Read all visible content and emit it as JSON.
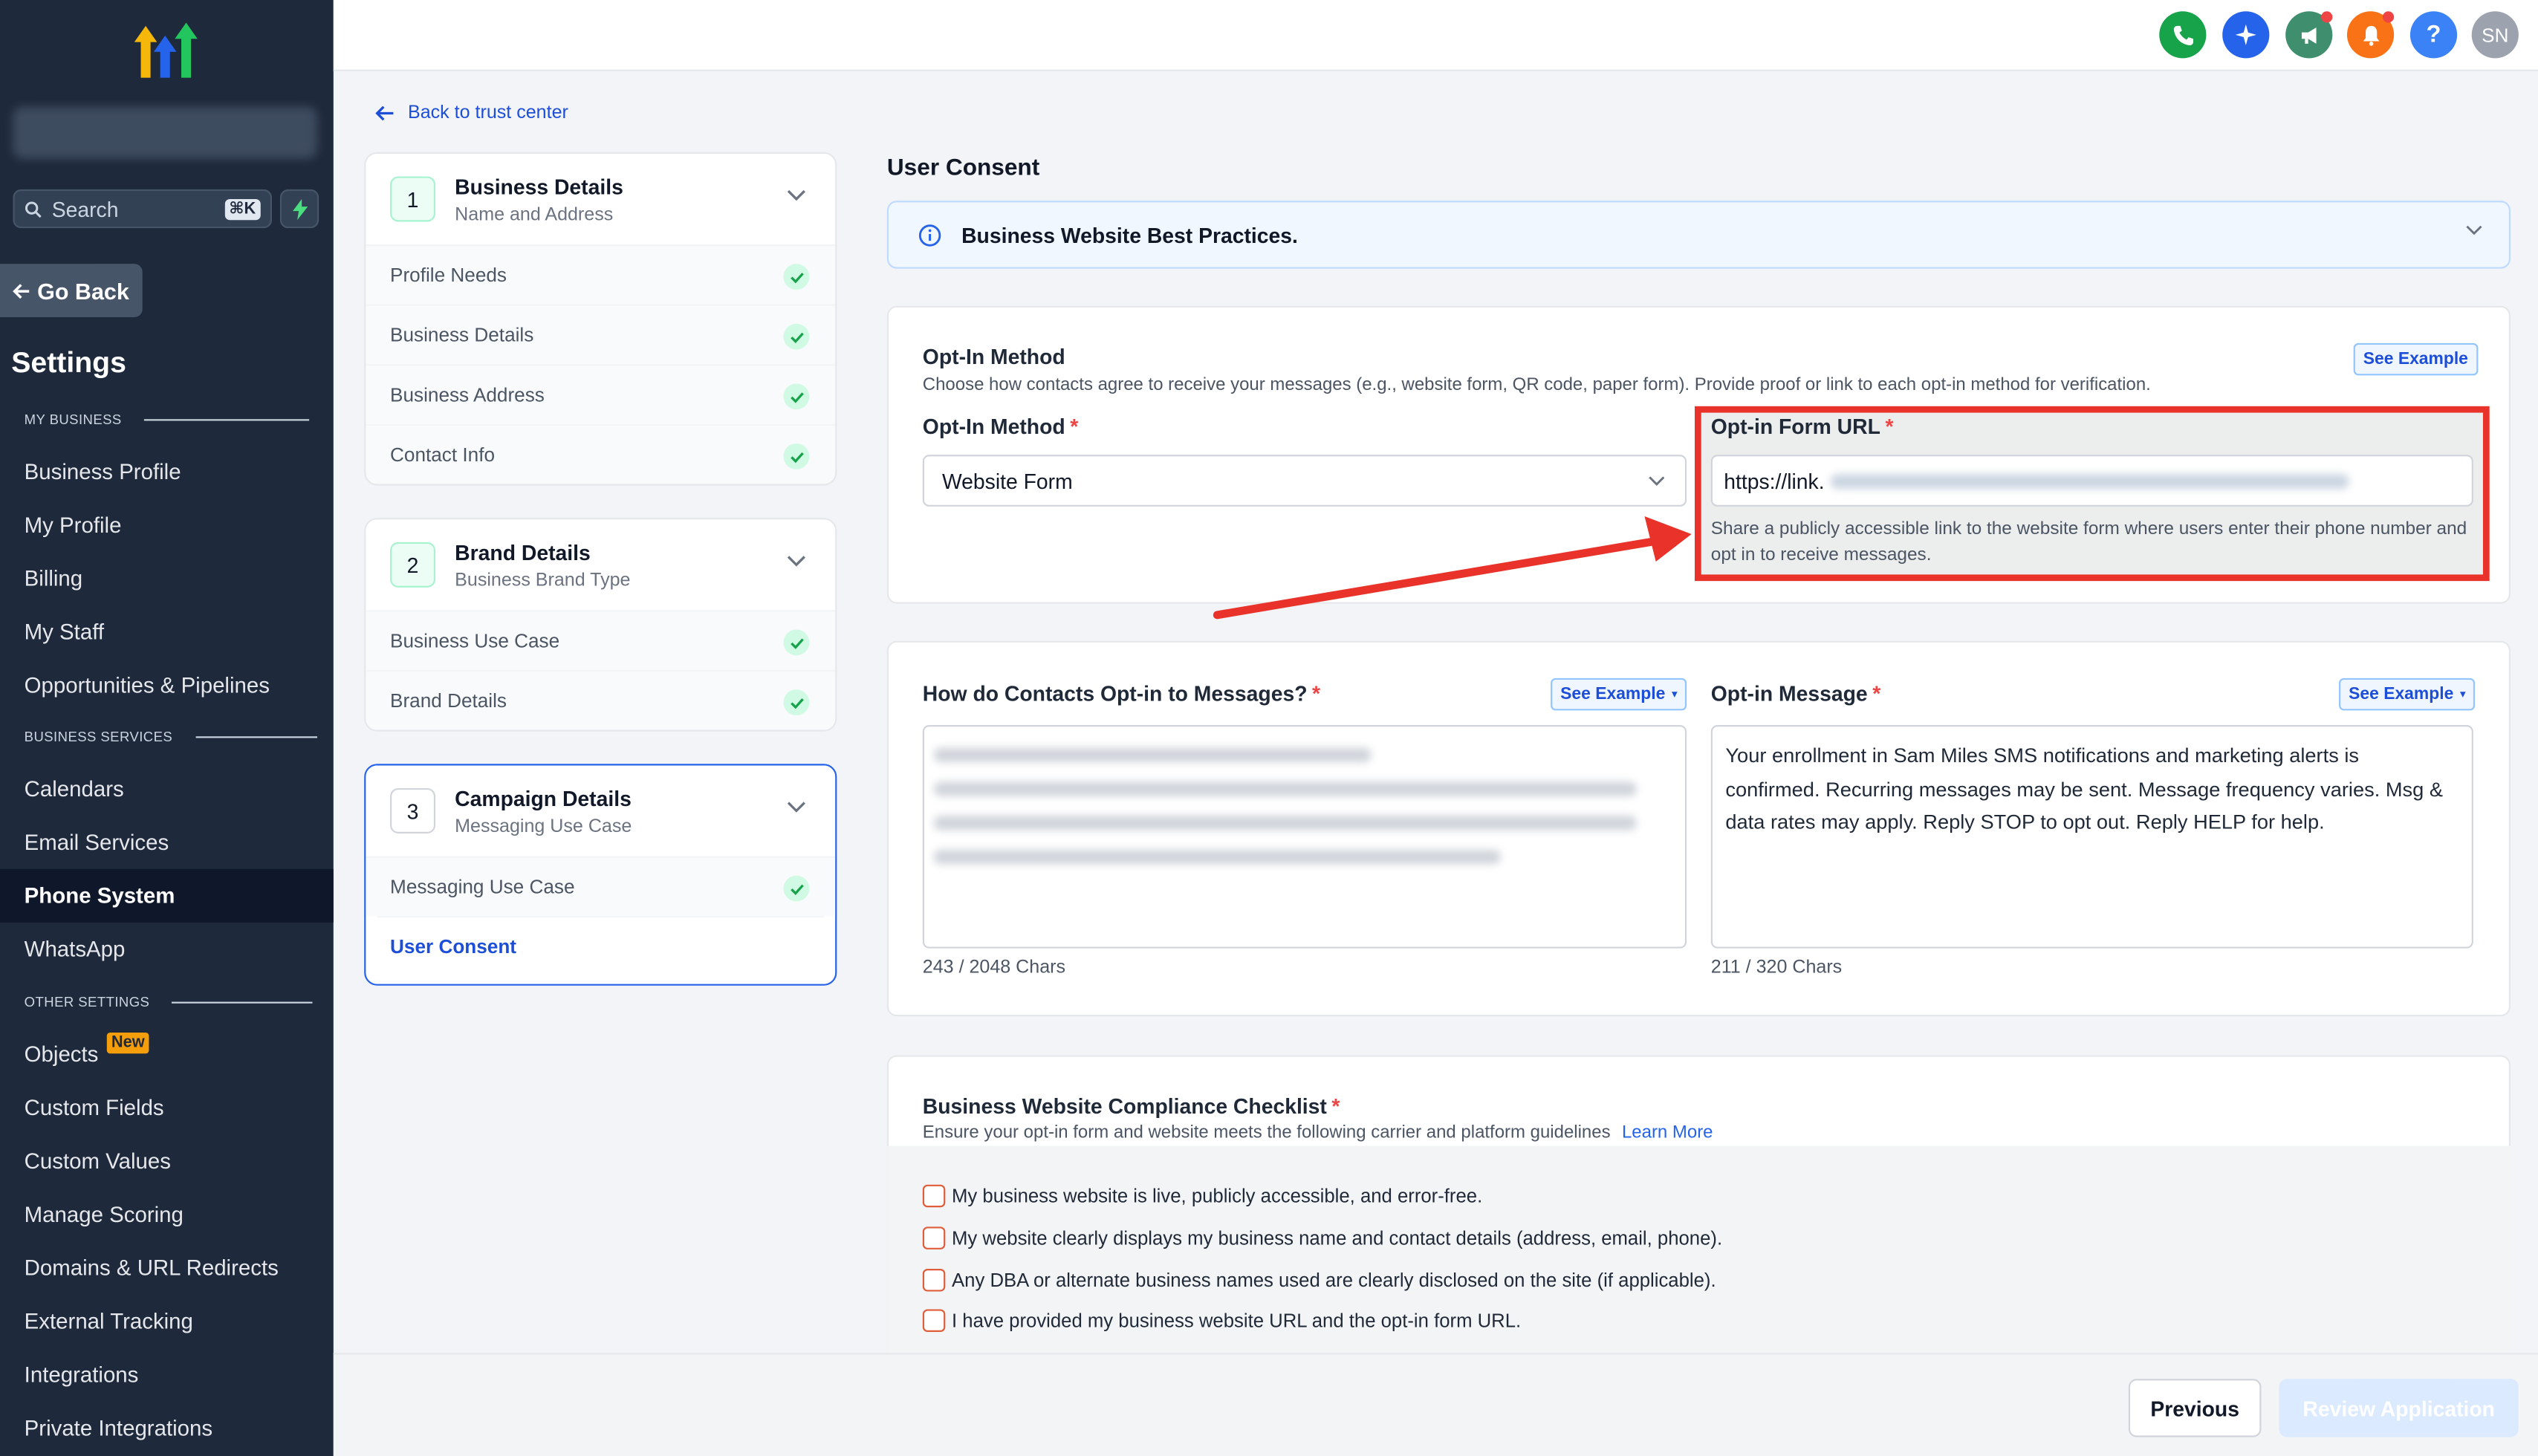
{
  "sidebar": {
    "search_placeholder": "Search",
    "search_shortcut": "⌘K",
    "go_back": "Go Back",
    "settings_title": "Settings",
    "sections": {
      "my_business": "MY BUSINESS",
      "business_services": "BUSINESS SERVICES",
      "other_settings": "OTHER SETTINGS"
    },
    "items": [
      {
        "label": "Business Profile"
      },
      {
        "label": "My Profile"
      },
      {
        "label": "Billing"
      },
      {
        "label": "My Staff"
      },
      {
        "label": "Opportunities & Pipelines"
      },
      {
        "label": "Calendars"
      },
      {
        "label": "Email Services"
      },
      {
        "label": "Phone System",
        "active": true
      },
      {
        "label": "WhatsApp"
      },
      {
        "label": "Objects",
        "badge": "New"
      },
      {
        "label": "Custom Fields"
      },
      {
        "label": "Custom Values"
      },
      {
        "label": "Manage Scoring"
      },
      {
        "label": "Domains & URL Redirects"
      },
      {
        "label": "External Tracking"
      },
      {
        "label": "Integrations"
      },
      {
        "label": "Private Integrations"
      }
    ]
  },
  "topbar": {
    "avatar_initials": "SN",
    "help_label": "?",
    "colors": {
      "phone": "#16a34a",
      "ai": "#2563eb",
      "announce": "#3f8f6e",
      "bell": "#f97316",
      "help": "#3b82f6",
      "avatar": "#9ca3af"
    }
  },
  "back_link": "Back to trust center",
  "steps": [
    {
      "num": "1",
      "title": "Business Details",
      "subtitle": "Name and Address",
      "items": [
        "Profile Needs",
        "Business Details",
        "Business Address",
        "Contact Info"
      ]
    },
    {
      "num": "2",
      "title": "Brand Details",
      "subtitle": "Business Brand Type",
      "items": [
        "Business Use Case",
        "Brand Details"
      ]
    },
    {
      "num": "3",
      "title": "Campaign Details",
      "subtitle": "Messaging Use Case",
      "items": [
        "Messaging Use Case"
      ],
      "current": "User Consent"
    }
  ],
  "page_title": "User Consent",
  "banner_text": "Business Website Best Practices.",
  "opt_in": {
    "section_title": "Opt-In Method",
    "section_desc": "Choose how contacts agree to receive your messages (e.g., website form, QR code, paper form). Provide proof or link to each opt-in method for verification.",
    "see_example": "See Example",
    "method_label": "Opt-In Method",
    "method_value": "Website Form",
    "url_label": "Opt-in Form URL",
    "url_value": "https://link.",
    "url_help": "Share a publicly accessible link to the website form where users enter their phone number and opt in to receive messages."
  },
  "messages": {
    "how_label": "How do Contacts Opt-in to Messages?",
    "how_see_example": "See Example",
    "how_chars": "243 / 2048 Chars",
    "msg_label": "Opt-in Message",
    "msg_see_example": "See Example",
    "msg_value": "Your enrollment in Sam Miles SMS notifications and marketing alerts is confirmed. Recurring messages may be sent. Message frequency varies. Msg & data rates may apply. Reply STOP to opt out. Reply HELP for help.",
    "msg_chars": "211 / 320 Chars"
  },
  "compliance": {
    "title": "Business Website Compliance Checklist",
    "desc": "Ensure your opt-in form and website meets the following carrier and platform guidelines",
    "learn_more": "Learn More",
    "items": [
      "My business website is live, publicly accessible, and error-free.",
      "My website clearly displays my business name and contact details (address, email, phone).",
      "Any DBA or alternate business names used are clearly disclosed on the site (if applicable).",
      "I have provided my business website URL and the opt-in form URL."
    ]
  },
  "footer": {
    "previous": "Previous",
    "review": "Review Application"
  }
}
